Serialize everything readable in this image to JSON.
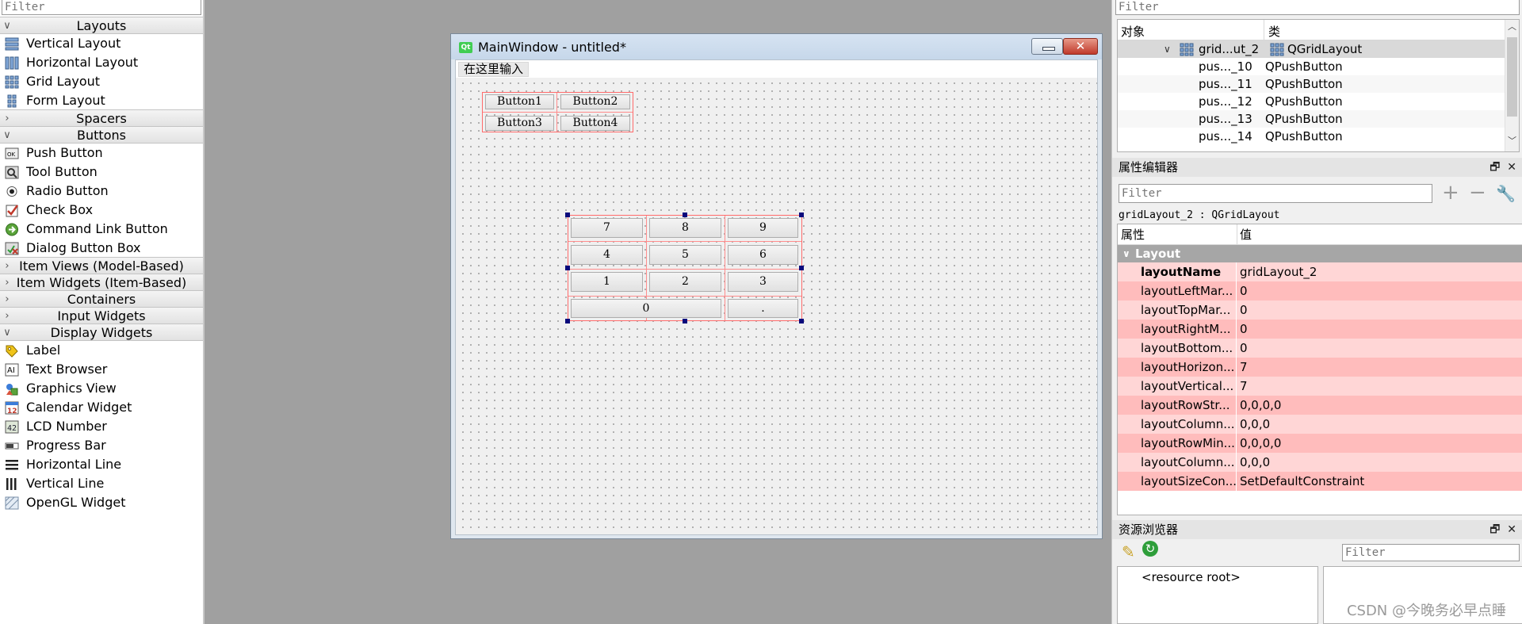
{
  "widget_box": {
    "filter_placeholder": "Filter",
    "categories": [
      {
        "label": "Layouts",
        "expanded": true,
        "items": [
          {
            "label": "Vertical Layout",
            "icon": "vertical-layout-icon"
          },
          {
            "label": "Horizontal Layout",
            "icon": "horizontal-layout-icon"
          },
          {
            "label": "Grid Layout",
            "icon": "grid-layout-icon"
          },
          {
            "label": "Form Layout",
            "icon": "form-layout-icon"
          }
        ]
      },
      {
        "label": "Spacers",
        "expanded": false,
        "items": []
      },
      {
        "label": "Buttons",
        "expanded": true,
        "items": [
          {
            "label": "Push Button",
            "icon": "push-button-icon"
          },
          {
            "label": "Tool Button",
            "icon": "tool-button-icon"
          },
          {
            "label": "Radio Button",
            "icon": "radio-button-icon"
          },
          {
            "label": "Check Box",
            "icon": "check-box-icon"
          },
          {
            "label": "Command Link Button",
            "icon": "command-link-icon"
          },
          {
            "label": "Dialog Button Box",
            "icon": "dialog-button-box-icon"
          }
        ]
      },
      {
        "label": "Item Views (Model-Based)",
        "expanded": false,
        "items": []
      },
      {
        "label": "Item Widgets (Item-Based)",
        "expanded": false,
        "items": []
      },
      {
        "label": "Containers",
        "expanded": false,
        "items": []
      },
      {
        "label": "Input Widgets",
        "expanded": false,
        "items": []
      },
      {
        "label": "Display Widgets",
        "expanded": true,
        "items": [
          {
            "label": "Label",
            "icon": "label-icon"
          },
          {
            "label": "Text Browser",
            "icon": "text-browser-icon"
          },
          {
            "label": "Graphics View",
            "icon": "graphics-view-icon"
          },
          {
            "label": "Calendar Widget",
            "icon": "calendar-icon"
          },
          {
            "label": "LCD Number",
            "icon": "lcd-number-icon"
          },
          {
            "label": "Progress Bar",
            "icon": "progress-bar-icon"
          },
          {
            "label": "Horizontal Line",
            "icon": "horizontal-line-icon"
          },
          {
            "label": "Vertical Line",
            "icon": "vertical-line-icon"
          },
          {
            "label": "OpenGL Widget",
            "icon": "opengl-widget-icon"
          }
        ]
      }
    ]
  },
  "main_window": {
    "title": "MainWindow - untitled*",
    "logo_text": "Qt",
    "menu_placeholder": "在这里输入",
    "small_grid": [
      "Button1",
      "Button2",
      "Button3",
      "Button4"
    ],
    "keypad": {
      "rows": [
        [
          "7",
          "8",
          "9"
        ],
        [
          "4",
          "5",
          "6"
        ],
        [
          "1",
          "2",
          "3"
        ]
      ],
      "zero": "0",
      "dot": "."
    }
  },
  "object_inspector": {
    "filter_placeholder": "Filter",
    "col_object": "对象",
    "col_class": "类",
    "rows": [
      {
        "name": "grid...ut_2",
        "class": "QGridLayout",
        "selected": true,
        "indent": 1
      },
      {
        "name": "pus..._10",
        "class": "QPushButton",
        "selected": false,
        "indent": 2
      },
      {
        "name": "pus..._11",
        "class": "QPushButton",
        "selected": false,
        "indent": 2
      },
      {
        "name": "pus..._12",
        "class": "QPushButton",
        "selected": false,
        "indent": 2
      },
      {
        "name": "pus..._13",
        "class": "QPushButton",
        "selected": false,
        "indent": 2
      },
      {
        "name": "pus..._14",
        "class": "QPushButton",
        "selected": false,
        "indent": 2
      }
    ]
  },
  "property_editor": {
    "title": "属性编辑器",
    "filter_placeholder": "Filter",
    "object_caption": "gridLayout_2 : QGridLayout",
    "col_property": "属性",
    "col_value": "值",
    "group": "Layout",
    "rows": [
      {
        "name": "layoutName",
        "value": "gridLayout_2",
        "bold": true
      },
      {
        "name": "layoutLeftMar...",
        "value": "0"
      },
      {
        "name": "layoutTopMar...",
        "value": "0"
      },
      {
        "name": "layoutRightM...",
        "value": "0"
      },
      {
        "name": "layoutBottom...",
        "value": "0"
      },
      {
        "name": "layoutHorizon...",
        "value": "7"
      },
      {
        "name": "layoutVertical...",
        "value": "7"
      },
      {
        "name": "layoutRowStr...",
        "value": "0,0,0,0"
      },
      {
        "name": "layoutColumn...",
        "value": "0,0,0"
      },
      {
        "name": "layoutRowMin...",
        "value": "0,0,0,0"
      },
      {
        "name": "layoutColumn...",
        "value": "0,0,0"
      },
      {
        "name": "layoutSizeCon...",
        "value": "SetDefaultConstraint"
      }
    ]
  },
  "resource_browser": {
    "title": "资源浏览器",
    "filter_placeholder": "Filter",
    "root": "<resource root>"
  },
  "watermark": "CSDN @今晚务必早点睡"
}
